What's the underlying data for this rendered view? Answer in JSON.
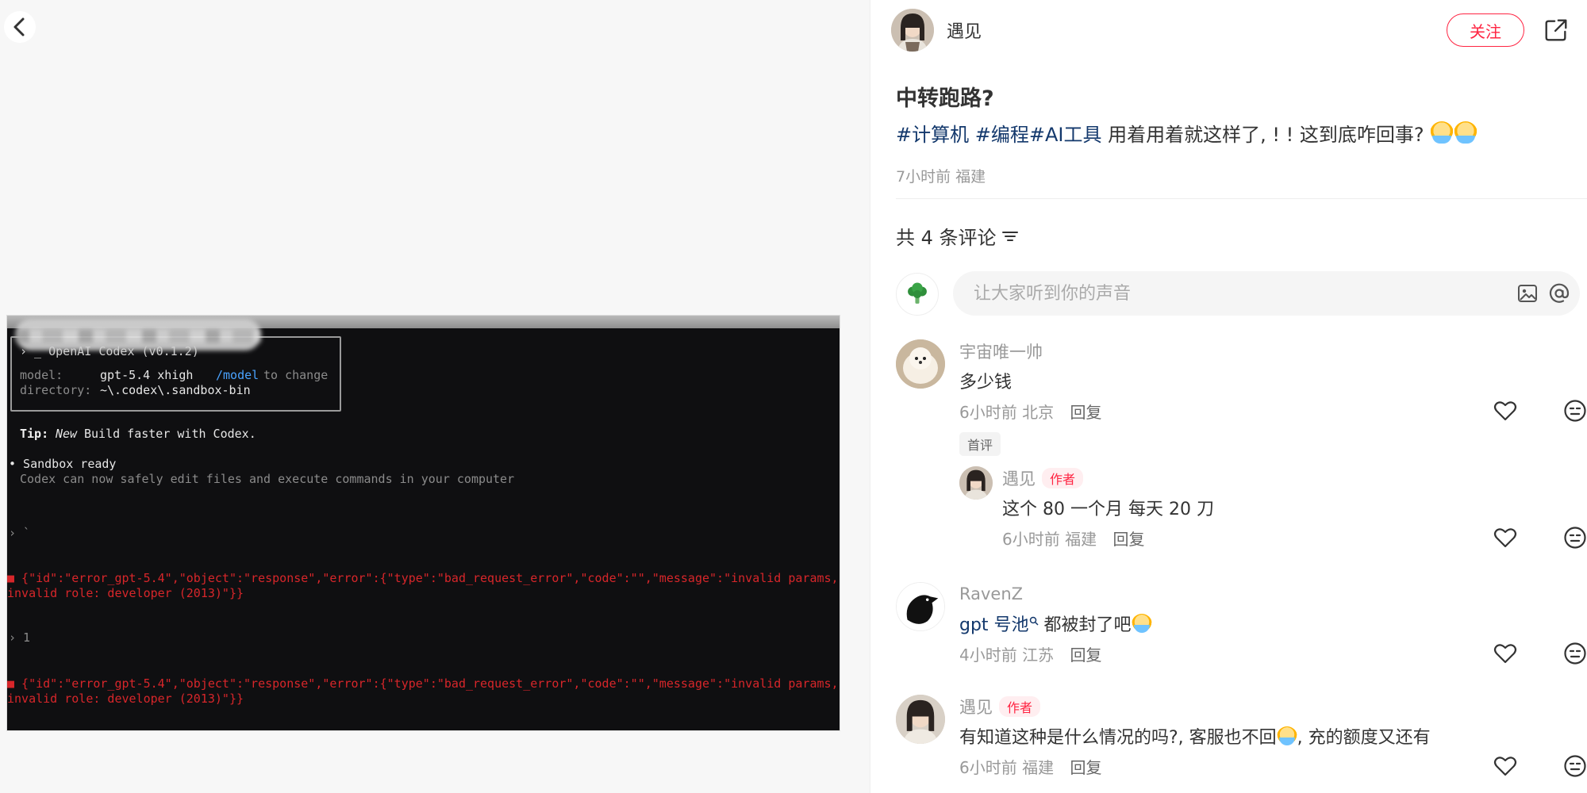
{
  "terminal": {
    "header_blurred": "› _ OpenAI Codex (v0.1.2)",
    "model_label": "model:",
    "model_value": "gpt-5.4 xhigh",
    "model_cmd": "/model",
    "model_hint": "to change",
    "dir_label": "directory:",
    "dir_value": "~\\.codex\\.sandbox-bin",
    "tip_label": "Tip:",
    "tip_new": "New",
    "tip_text": "Build faster with Codex.",
    "sandbox_title": "• Sandbox ready",
    "sandbox_desc": "Codex can now safely edit files and execute commands in your computer",
    "prompt1": "› `",
    "error1_a": "■ {\"id\":\"error_gpt-5.4\",\"object\":\"response\",\"error\":{\"type\":\"bad_request_error\",\"code\":\"\",\"message\":\"invalid params,",
    "error1_b": "invalid role: developer (2013)\"}}",
    "prompt2": "› 1",
    "error2_a": "■ {\"id\":\"error_gpt-5.4\",\"object\":\"response\",\"error\":{\"type\":\"bad_request_error\",\"code\":\"\",\"message\":\"invalid params,",
    "error2_b": "invalid role: developer (2013)\"}}"
  },
  "header": {
    "author": "遇见",
    "follow_label": "关注"
  },
  "post": {
    "title": "中转跑路?",
    "tags": [
      "#计算机",
      "#编程",
      "#AI工具"
    ],
    "body": "用着用着就这样了, ! !   这到底咋回事?",
    "meta": "7小时前 福建"
  },
  "comments_section": {
    "count_label": "共 4 条评论",
    "input_placeholder": "让大家听到你的声音"
  },
  "comments": [
    {
      "name": "宇宙唯一帅",
      "text": "多少钱",
      "meta": "6小时前 北京",
      "reply_label": "回复",
      "tag": "首评"
    },
    {
      "name": "遇见",
      "badge": "作者",
      "text": "这个 80 一个月 每天 20 刀",
      "meta": "6小时前 福建",
      "reply_label": "回复"
    },
    {
      "name": "RavenZ",
      "mention": "gpt 号池",
      "text": " 都被封了吧",
      "meta": "4小时前 江苏",
      "reply_label": "回复"
    },
    {
      "name": "遇见",
      "badge": "作者",
      "text_a": "有知道这种是什么情况的吗?, 客服也不回",
      "text_b": ", 充的额度又还有",
      "meta": "6小时前 福建",
      "reply_label": "回复"
    }
  ]
}
